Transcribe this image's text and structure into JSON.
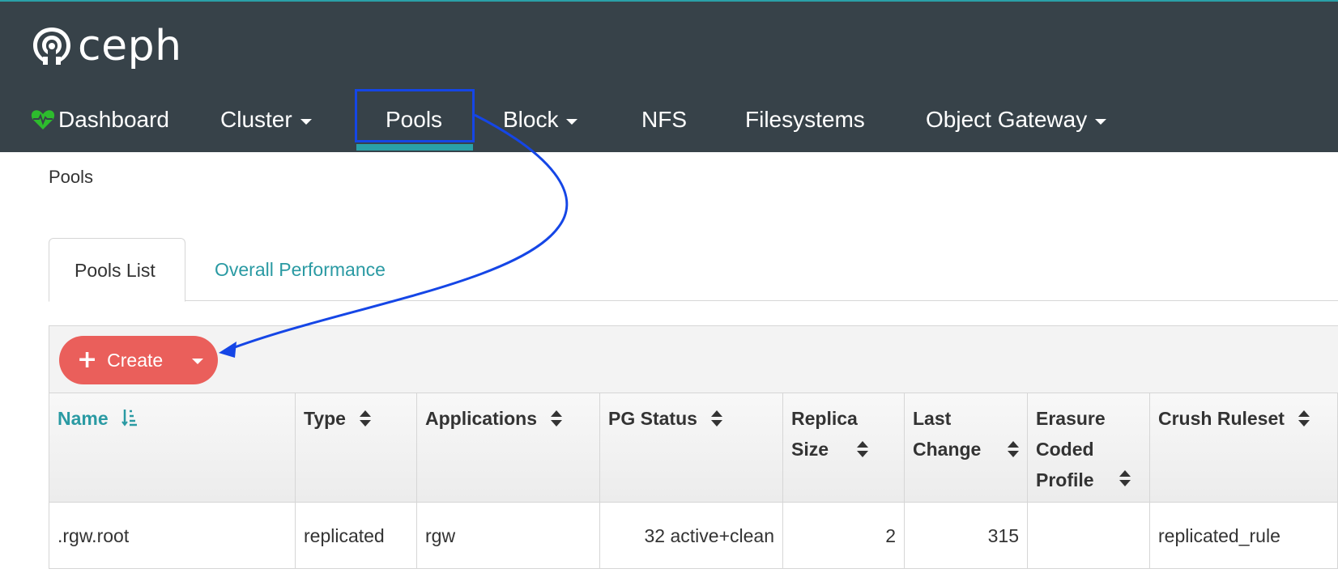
{
  "app": {
    "brand": "ceph"
  },
  "nav": {
    "items": [
      {
        "label": "Dashboard",
        "has_caret": false
      },
      {
        "label": "Cluster",
        "has_caret": true
      },
      {
        "label": "Pools",
        "has_caret": false,
        "active": true
      },
      {
        "label": "Block",
        "has_caret": true
      },
      {
        "label": "NFS",
        "has_caret": false
      },
      {
        "label": "Filesystems",
        "has_caret": false
      },
      {
        "label": "Object Gateway",
        "has_caret": true
      }
    ]
  },
  "breadcrumb": "Pools",
  "tabs": [
    {
      "label": "Pools List",
      "active": true
    },
    {
      "label": "Overall Performance",
      "active": false
    }
  ],
  "toolbar": {
    "create_label": "Create",
    "create_icon": "plus-icon"
  },
  "table": {
    "columns": [
      {
        "label": "Name",
        "sort": "sorted-ascending-icon"
      },
      {
        "label": "Type",
        "sort": "sortable-icon"
      },
      {
        "label": "Applications",
        "sort": "sortable-icon"
      },
      {
        "label": "PG Status",
        "sort": "sortable-icon"
      },
      {
        "label": "Replica Size",
        "sort": "sortable-icon"
      },
      {
        "label": "Last Change",
        "sort": "sortable-icon"
      },
      {
        "label": "Erasure Coded Profile",
        "sort": "sortable-icon"
      },
      {
        "label": "Crush Ruleset",
        "sort": "sortable-icon"
      }
    ],
    "rows": [
      {
        "name": ".rgw.root",
        "type": "replicated",
        "applications": "rgw",
        "pg_status": "32 active+clean",
        "replica_size": "2",
        "last_change": "315",
        "erasure_coded_profile": "",
        "crush_ruleset": "replicated_rule"
      }
    ]
  },
  "colors": {
    "navbar": "#374249",
    "accent": "#2aa0a8",
    "create_button": "#ea5f5b",
    "pg_ok": "#2dbc2d",
    "annotation": "#1546e6"
  }
}
